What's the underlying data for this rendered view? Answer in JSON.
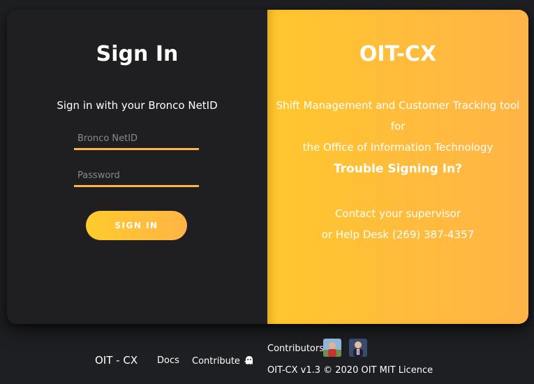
{
  "signin": {
    "title": "Sign In",
    "subtitle": "Sign in with your Bronco NetID",
    "netid_placeholder": "Bronco NetID",
    "password_placeholder": "Password",
    "button_label": "SIGN IN"
  },
  "info": {
    "app_title": "OIT-CX",
    "description_line1": "Shift Management and Customer Tracking tool for",
    "description_line2": "the Office of Information Technology",
    "trouble_heading": "Trouble Signing In?",
    "contact_line1": "Contact your supervisor",
    "contact_line2": "or Help Desk (269) 387-4357"
  },
  "footer": {
    "brand": "OIT - CX",
    "docs_label": "Docs",
    "contribute_label": "Contribute",
    "contribute_icon": "ghost-icon",
    "contributors_label": "Contributors",
    "version_text": "OIT-CX v1.3 © 2020 OIT MIT Licence"
  },
  "colors": {
    "background": "#1e1f22",
    "panel_dark": "#1f1f21",
    "accent_gold": "#ffc72c",
    "accent_orange": "#ffb446"
  }
}
